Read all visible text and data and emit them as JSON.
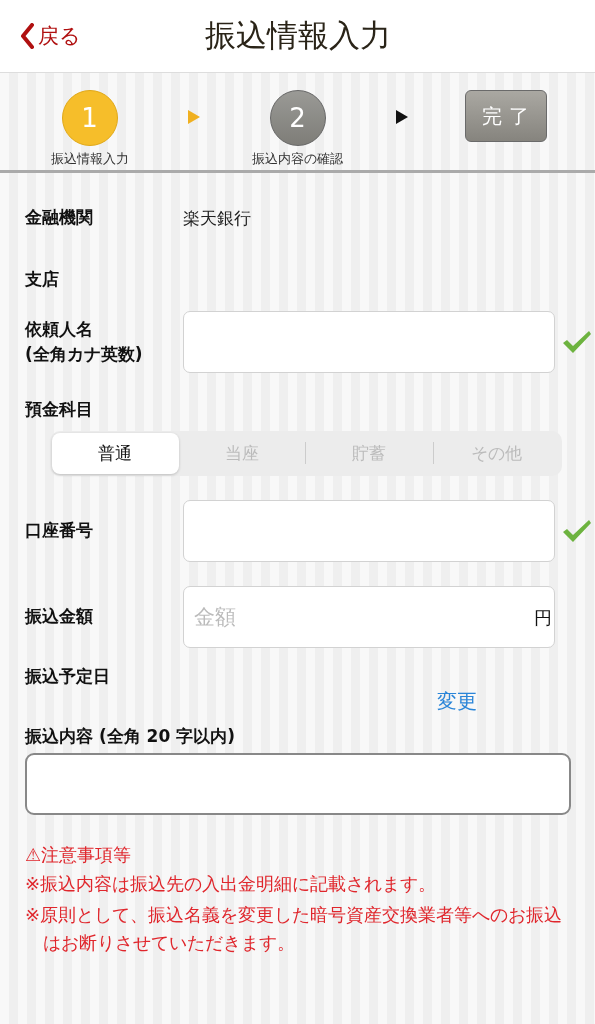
{
  "header": {
    "back_label": "戻る",
    "title": "振込情報入力"
  },
  "steps": [
    {
      "kind": "circle",
      "number": "1",
      "label": "振込情報入力",
      "selected": true
    },
    {
      "kind": "circle",
      "number": "2",
      "label": "振込内容の確認",
      "selected": false
    },
    {
      "kind": "box",
      "number": "完 了",
      "selected": false
    }
  ],
  "fields": [
    {
      "kind": "text",
      "label": "金融機関",
      "value": "楽天銀行"
    },
    {
      "kind": "blank",
      "label": "支店"
    },
    {
      "kind": "input",
      "label": "依頼人名\n(全角カナ英数)",
      "valid": true
    },
    {
      "kind": "segment",
      "label": "預金科目",
      "options": [
        {
          "label": "普通",
          "selected": true
        },
        {
          "label": "当座",
          "selected": false
        },
        {
          "label": "貯蓄",
          "selected": false
        },
        {
          "label": "その他",
          "selected": false
        }
      ]
    },
    {
      "kind": "input",
      "label": "口座番号",
      "valid": true
    },
    {
      "kind": "input",
      "label": "振込金額",
      "placeholder": "金額",
      "unit": "円",
      "valid": false
    },
    {
      "kind": "date",
      "label": "振込予定日",
      "action": "変更"
    },
    {
      "kind": "textarea",
      "label": "振込内容 (全角 20 字以内)"
    }
  ],
  "notice": {
    "title": "⚠注意事項等",
    "lines": [
      "※振込内容は振込先の入出金明細に記載されます。",
      "※原則として、振込名義を変更した暗号資産交換業者等へのお振込はお断りさせていただきます。"
    ]
  }
}
